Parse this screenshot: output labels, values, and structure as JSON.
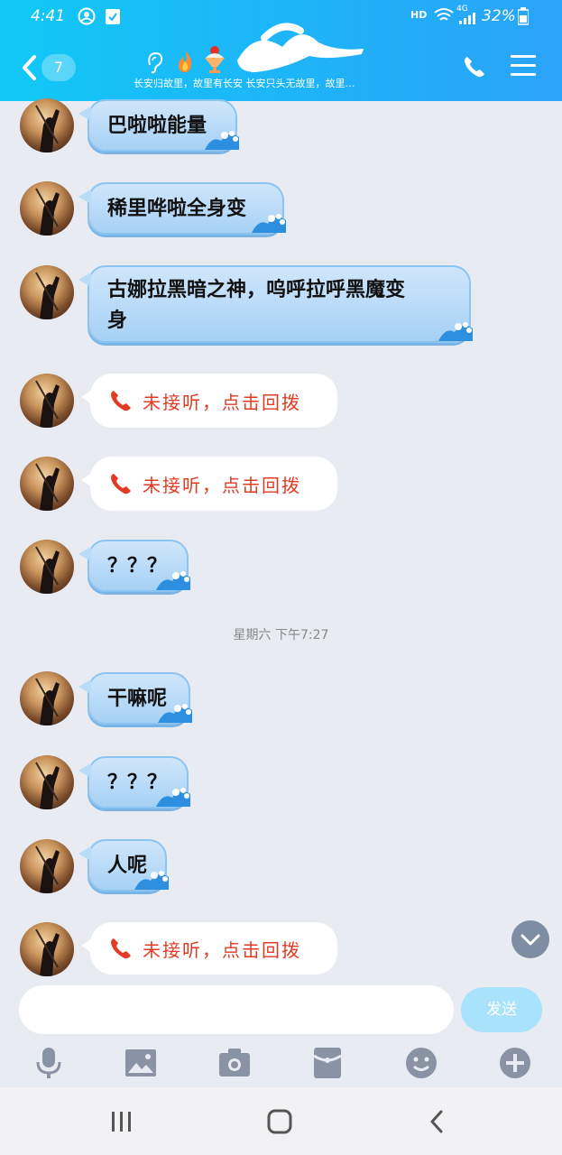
{
  "status_bar": {
    "time": "4:41",
    "hd": "HD",
    "network": "4G",
    "battery": "32%"
  },
  "header": {
    "unread_count": "7",
    "signature": "长安归故里，故里有长安  长安只头无故里，故里…"
  },
  "messages": [
    {
      "type": "text",
      "text": "巴啦啦能量"
    },
    {
      "type": "text",
      "text": "稀里哗啦全身变"
    },
    {
      "type": "text",
      "line1": "古娜拉黑暗之神，呜呼拉呼黑魔变",
      "line2": "身"
    },
    {
      "type": "missed_call",
      "text": "未接听，点击回拨"
    },
    {
      "type": "missed_call",
      "text": "未接听，点击回拨"
    },
    {
      "type": "text",
      "text": "？？？"
    },
    {
      "type": "timestamp",
      "text": "星期六 下午7:27"
    },
    {
      "type": "text",
      "text": "干嘛呢"
    },
    {
      "type": "text",
      "text": "？？？"
    },
    {
      "type": "text",
      "text": "人呢"
    },
    {
      "type": "missed_call",
      "text": "未接听，点击回拨"
    }
  ],
  "input": {
    "placeholder": "",
    "send_label": "发送"
  },
  "icons": {
    "back": "chevron-left-icon",
    "call": "phone-icon",
    "menu": "hamburger-icon",
    "ear": "ear-icon",
    "fire": "fire-icon",
    "sundae": "sundae-icon",
    "mic": "mic-icon",
    "image": "image-icon",
    "camera": "camera-icon",
    "redpacket": "red-packet-icon",
    "emoji": "emoji-icon",
    "plus": "plus-icon"
  },
  "colors": {
    "header_start": "#11c8f6",
    "header_end": "#2aa3f8",
    "missed_text": "#e23b24",
    "send_bg": "#a9e2fb"
  }
}
